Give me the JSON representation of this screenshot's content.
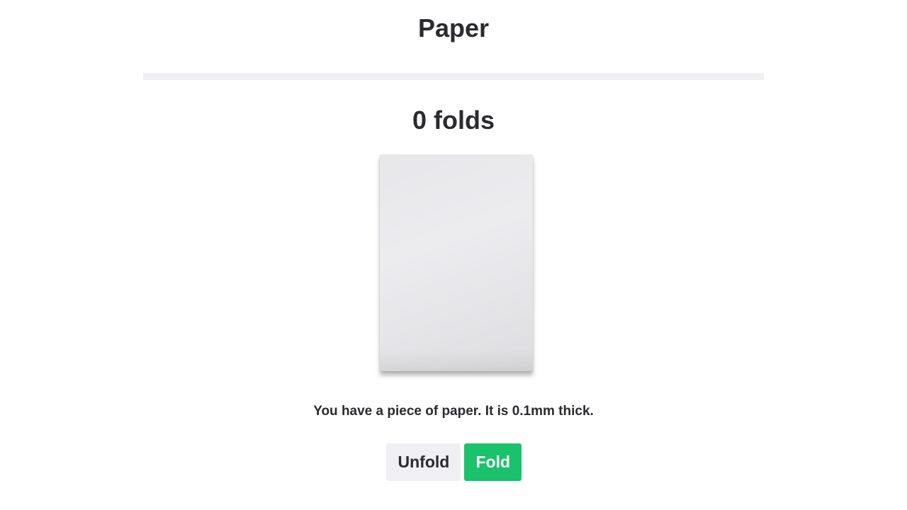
{
  "header": {
    "title": "Paper"
  },
  "main": {
    "folds_heading": "0 folds",
    "paper_image": "paper-sheet",
    "description": "You have a piece of paper. It is 0.1mm thick.",
    "buttons": {
      "unfold_label": "Unfold",
      "fold_label": "Fold"
    }
  },
  "colors": {
    "divider": "#efeff4",
    "fold_button": "#19c26b",
    "unfold_button": "#efeff4",
    "text": "#2b2b2f"
  }
}
